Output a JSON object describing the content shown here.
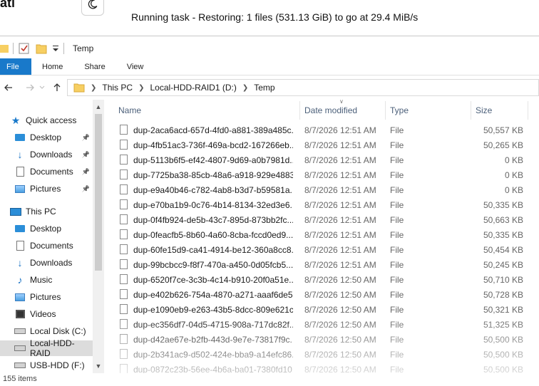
{
  "app": {
    "title": "ati"
  },
  "task": {
    "status": "Running task - Restoring: 1 files (531.13 GiB) to go at 29.4 MiB/s"
  },
  "window": {
    "title": "Temp"
  },
  "ribbon": {
    "tabs": [
      "File",
      "Home",
      "Share",
      "View"
    ]
  },
  "breadcrumb": [
    "This PC",
    "Local-HDD-RAID1 (D:)",
    "Temp"
  ],
  "nav": {
    "items": [
      {
        "label": "Quick access",
        "icon": "star-icon",
        "indent": 1,
        "pinned": false
      },
      {
        "label": "Desktop",
        "icon": "desktop-icon",
        "indent": 2,
        "pinned": true
      },
      {
        "label": "Downloads",
        "icon": "download-icon",
        "indent": 2,
        "pinned": true
      },
      {
        "label": "Documents",
        "icon": "document-icon",
        "indent": 2,
        "pinned": true
      },
      {
        "label": "Pictures",
        "icon": "pictures-icon",
        "indent": 2,
        "pinned": true
      },
      {
        "label": "This PC",
        "icon": "computer-icon",
        "indent": 1,
        "pinned": false
      },
      {
        "label": "Desktop",
        "icon": "desktop-icon",
        "indent": 2,
        "pinned": false
      },
      {
        "label": "Documents",
        "icon": "document-icon",
        "indent": 2,
        "pinned": false
      },
      {
        "label": "Downloads",
        "icon": "download-icon",
        "indent": 2,
        "pinned": false
      },
      {
        "label": "Music",
        "icon": "music-icon",
        "indent": 2,
        "pinned": false
      },
      {
        "label": "Pictures",
        "icon": "pictures-icon",
        "indent": 2,
        "pinned": false
      },
      {
        "label": "Videos",
        "icon": "video-icon",
        "indent": 2,
        "pinned": false
      },
      {
        "label": "Local Disk (C:)",
        "icon": "disk-icon",
        "indent": 2,
        "pinned": false
      },
      {
        "label": "Local-HDD-RAID",
        "icon": "disk-icon",
        "indent": 2,
        "pinned": false,
        "selected": true
      },
      {
        "label": "USB-HDD (F:)",
        "icon": "disk-icon",
        "indent": 2,
        "pinned": false
      }
    ]
  },
  "columns": {
    "name": "Name",
    "date": "Date modified",
    "type": "Type",
    "size": "Size"
  },
  "files": [
    {
      "name": "dup-2aca6acd-657d-4fd0-a881-389a485c...",
      "date": "8/7/2026 12:51 AM",
      "type": "File",
      "size": "50,557 KB"
    },
    {
      "name": "dup-4fb51ac3-736f-469a-bcd2-167266eb...",
      "date": "8/7/2026 12:51 AM",
      "type": "File",
      "size": "50,265 KB"
    },
    {
      "name": "dup-5113b6f5-ef42-4807-9d69-a0b7981d...",
      "date": "8/7/2026 12:51 AM",
      "type": "File",
      "size": "0 KB"
    },
    {
      "name": "dup-7725ba38-85cb-48a6-a918-929e4883...",
      "date": "8/7/2026 12:51 AM",
      "type": "File",
      "size": "0 KB"
    },
    {
      "name": "dup-e9a40b46-c782-4ab8-b3d7-b59581a...",
      "date": "8/7/2026 12:51 AM",
      "type": "File",
      "size": "0 KB"
    },
    {
      "name": "dup-e70ba1b9-0c76-4b14-8134-32ed3e6...",
      "date": "8/7/2026 12:51 AM",
      "type": "File",
      "size": "50,335 KB"
    },
    {
      "name": "dup-0f4fb924-de5b-43c7-895d-873bb2fc...",
      "date": "8/7/2026 12:51 AM",
      "type": "File",
      "size": "50,663 KB"
    },
    {
      "name": "dup-0feacfb5-8b60-4a60-8cba-fccd0ed9...",
      "date": "8/7/2026 12:51 AM",
      "type": "File",
      "size": "50,335 KB"
    },
    {
      "name": "dup-60fe15d9-ca41-4914-be12-360a8cc8...",
      "date": "8/7/2026 12:51 AM",
      "type": "File",
      "size": "50,454 KB"
    },
    {
      "name": "dup-99bcbcc9-f8f7-470a-a450-0d05fcb5...",
      "date": "8/7/2026 12:51 AM",
      "type": "File",
      "size": "50,245 KB"
    },
    {
      "name": "dup-6520f7ce-3c3b-4c14-b910-20f0a51e...",
      "date": "8/7/2026 12:50 AM",
      "type": "File",
      "size": "50,710 KB"
    },
    {
      "name": "dup-e402b626-754a-4870-a271-aaaf6de5...",
      "date": "8/7/2026 12:50 AM",
      "type": "File",
      "size": "50,728 KB"
    },
    {
      "name": "dup-e1090eb9-e263-43b5-8dcc-809e621c...",
      "date": "8/7/2026 12:50 AM",
      "type": "File",
      "size": "50,321 KB"
    },
    {
      "name": "dup-ec356df7-04d5-4715-908a-717dc82f...",
      "date": "8/7/2026 12:50 AM",
      "type": "File",
      "size": "51,325 KB"
    },
    {
      "name": "dup-d42ae67e-b2fb-443d-9e7e-73817f9c...",
      "date": "8/7/2026 12:50 AM",
      "type": "File",
      "size": "50,500 KB"
    },
    {
      "name": "dup-2b341ac9-d502-424e-bba9-a14efc86...",
      "date": "8/7/2026 12:50 AM",
      "type": "File",
      "size": "50,500 KB"
    },
    {
      "name": "dup-0872c23b-56ee-4b6a-ba01-7380fd10...",
      "date": "8/7/2026 12:50 AM",
      "type": "File",
      "size": "50,500 KB"
    }
  ],
  "status": {
    "items": "155 items"
  }
}
